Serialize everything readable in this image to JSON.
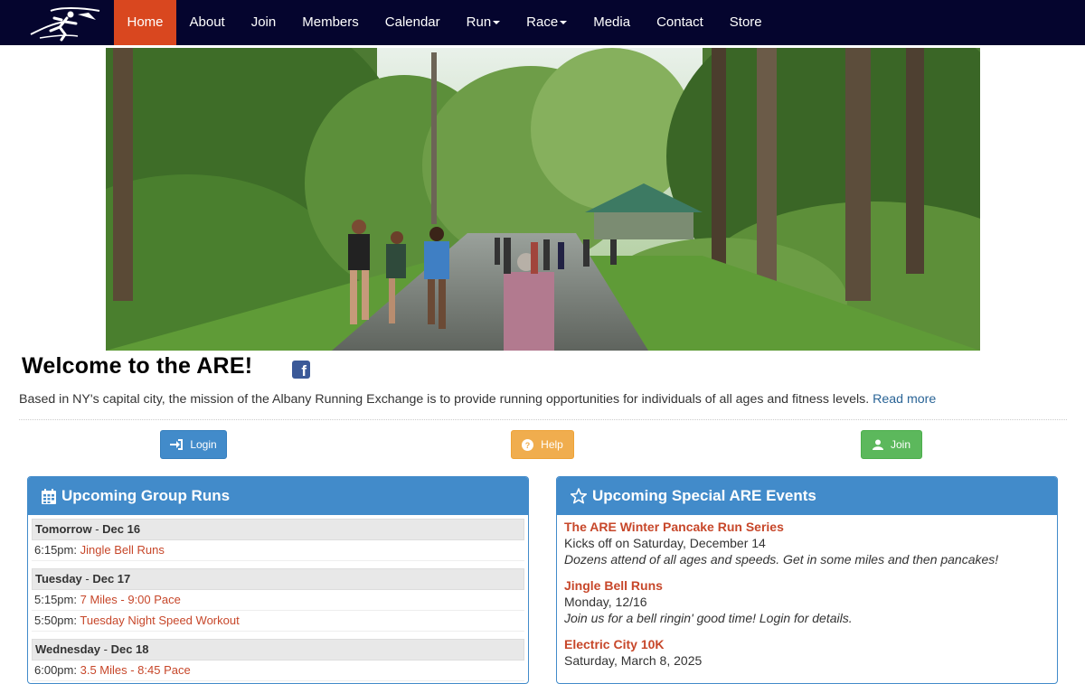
{
  "nav": {
    "items": [
      {
        "label": "Home",
        "active": true,
        "dropdown": false
      },
      {
        "label": "About",
        "active": false,
        "dropdown": false
      },
      {
        "label": "Join",
        "active": false,
        "dropdown": false
      },
      {
        "label": "Members",
        "active": false,
        "dropdown": false
      },
      {
        "label": "Calendar",
        "active": false,
        "dropdown": false
      },
      {
        "label": "Run",
        "active": false,
        "dropdown": true
      },
      {
        "label": "Race",
        "active": false,
        "dropdown": true
      },
      {
        "label": "Media",
        "active": false,
        "dropdown": false
      },
      {
        "label": "Contact",
        "active": false,
        "dropdown": false
      },
      {
        "label": "Store",
        "active": false,
        "dropdown": false
      }
    ]
  },
  "welcome": {
    "title": "Welcome to the ARE!",
    "facebook_icon": "facebook-icon",
    "mission": "Based in NY's capital city, the mission of the Albany Running Exchange is to provide running opportunities for individuals of all ages and fitness levels.",
    "read_more": "Read more"
  },
  "buttons": {
    "login": "Login",
    "help": "Help",
    "join": "Join"
  },
  "group_runs": {
    "title": "Upcoming Group Runs",
    "icon": "calendar-icon",
    "days": [
      {
        "day": "Tomorrow",
        "date": "Dec 16",
        "runs": [
          {
            "time": "6:15pm",
            "name": "Jingle Bell Runs"
          }
        ]
      },
      {
        "day": "Tuesday",
        "date": "Dec 17",
        "runs": [
          {
            "time": "5:15pm",
            "name": "7 Miles - 9:00 Pace"
          },
          {
            "time": "5:50pm",
            "name": "Tuesday Night Speed Workout"
          }
        ]
      },
      {
        "day": "Wednesday",
        "date": "Dec 18",
        "runs": [
          {
            "time": "6:00pm",
            "name": "3.5 Miles - 8:45 Pace"
          }
        ]
      }
    ]
  },
  "special_events": {
    "title": "Upcoming Special ARE Events",
    "icon": "star-icon",
    "events": [
      {
        "title": "The ARE Winter Pancake Run Series",
        "date": "Kicks off on Saturday, December 14",
        "desc": "Dozens attend of all ages and speeds. Get in some miles and then pancakes!"
      },
      {
        "title": "Jingle Bell Runs",
        "date": "Monday, 12/16",
        "desc": "Join us for a bell ringin' good time! Login for details."
      },
      {
        "title": "Electric City 10K",
        "date": "Saturday, March 8, 2025",
        "desc": ""
      }
    ]
  },
  "colors": {
    "navbar": "#05052e",
    "active_nav": "#d9471f",
    "panel": "#428bca",
    "link": "#c7472a"
  }
}
